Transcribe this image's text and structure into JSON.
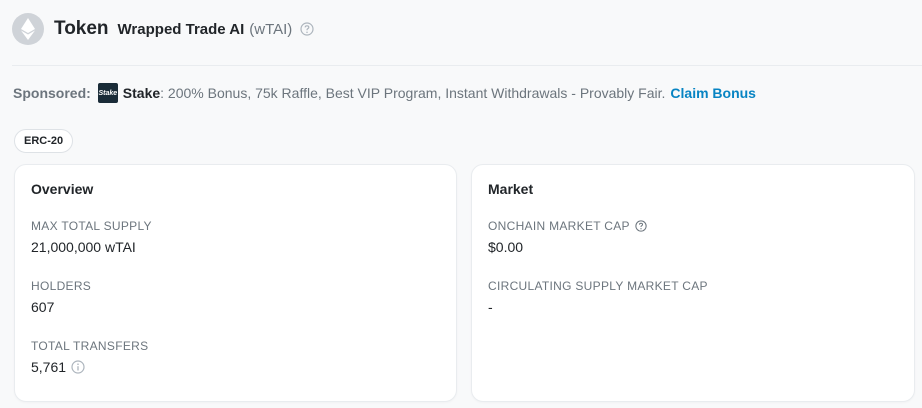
{
  "header": {
    "title": "Token",
    "token_name": "Wrapped Trade AI",
    "token_symbol": "(wTAI)",
    "logo_icon": "ethereum-icon",
    "help_icon": "question-circle-icon"
  },
  "sponsor": {
    "label": "Sponsored:",
    "brand_logo_text": "Stake",
    "brand": "Stake",
    "message": ": 200% Bonus, 75k Raffle, Best VIP Program, Instant Withdrawals - Provably Fair.",
    "cta": "Claim Bonus",
    "cta_color": "#0784c3"
  },
  "badge": {
    "label": "ERC-20"
  },
  "overview": {
    "title": "Overview",
    "max_supply": {
      "label": "MAX TOTAL SUPPLY",
      "value": "21,000,000 wTAI"
    },
    "holders": {
      "label": "HOLDERS",
      "value": "607"
    },
    "transfers": {
      "label": "TOTAL TRANSFERS",
      "value": "5,761",
      "icon": "info-circle-icon"
    }
  },
  "market": {
    "title": "Market",
    "onchain_cap": {
      "label": "ONCHAIN MARKET CAP",
      "value": "$0.00",
      "icon": "question-circle-icon"
    },
    "circulating_cap": {
      "label": "CIRCULATING SUPPLY MARKET CAP",
      "value": "-"
    }
  }
}
